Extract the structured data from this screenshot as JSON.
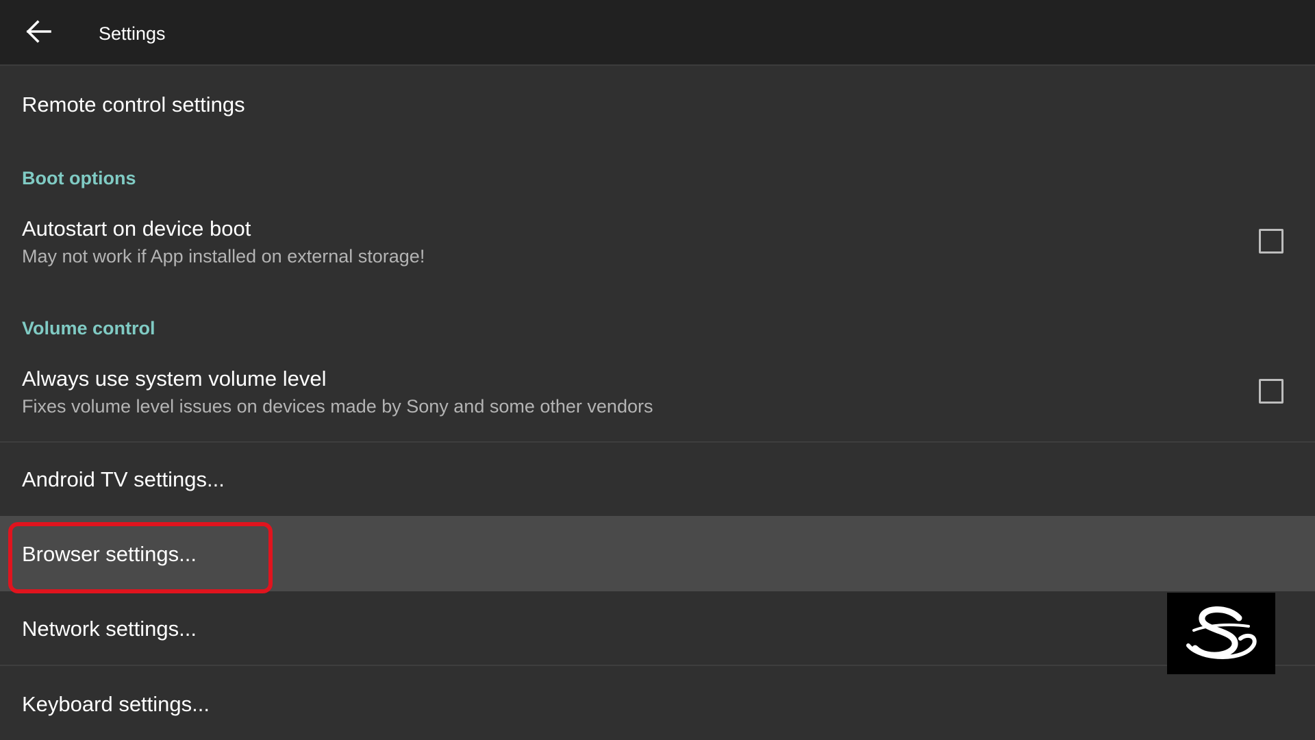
{
  "appbar": {
    "back_icon": "arrow-left-icon",
    "title": "Settings"
  },
  "items": {
    "remote_control": {
      "title": "Remote control settings"
    },
    "boot_category": "Boot options",
    "autostart": {
      "title": "Autostart on device boot",
      "summary": "May not work if App installed on external storage!",
      "checked": false
    },
    "volume_category": "Volume control",
    "system_volume": {
      "title": "Always use system volume level",
      "summary": "Fixes volume level issues on devices made by Sony and some other vendors",
      "checked": false
    },
    "android_tv": {
      "title": "Android TV settings..."
    },
    "browser": {
      "title": "Browser settings...",
      "selected": true
    },
    "network": {
      "title": "Network settings..."
    },
    "keyboard": {
      "title": "Keyboard settings..."
    }
  },
  "colors": {
    "appbar_bg": "#212121",
    "page_bg": "#303030",
    "category_accent": "#80cbc4",
    "selected_row_bg": "#4a4a4a",
    "highlight_annotation": "#e0141e"
  },
  "overlay": {
    "highlight_target": "Browser settings...",
    "watermark_logo": "S"
  }
}
